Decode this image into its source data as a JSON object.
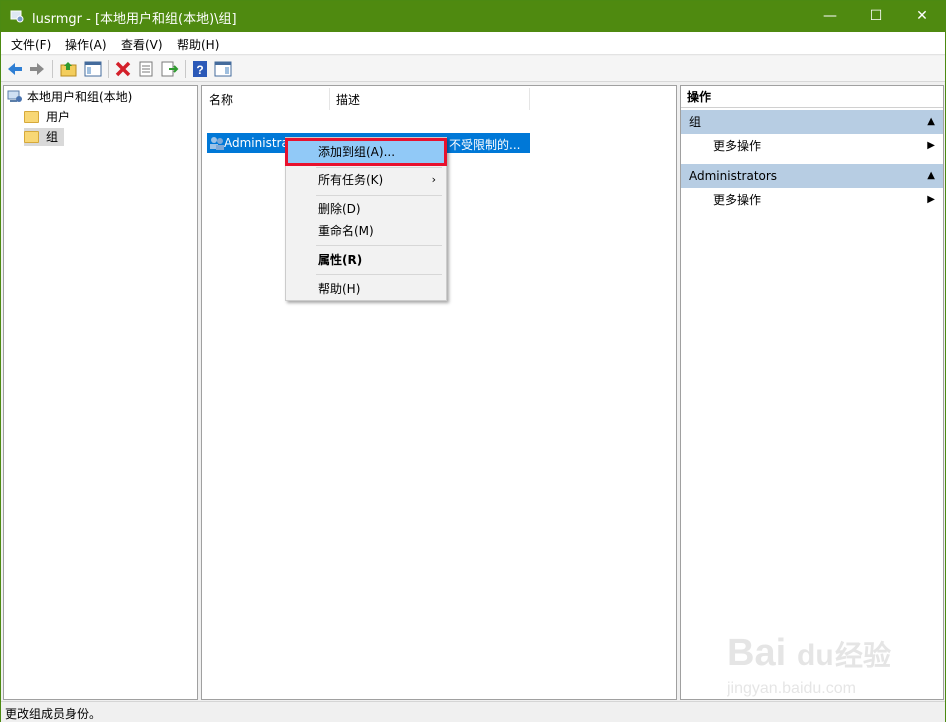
{
  "window": {
    "title": "lusrmgr - [本地用户和组(本地)\\组]",
    "accent": "#4f8a10",
    "min_glyph": "—",
    "max_glyph": "☐",
    "close_glyph": "✕"
  },
  "menubar": {
    "items": [
      {
        "label": "文件(F)"
      },
      {
        "label": "操作(A)"
      },
      {
        "label": "查看(V)"
      },
      {
        "label": "帮助(H)"
      }
    ]
  },
  "toolbar": {
    "icons": [
      "back-arrow-icon",
      "forward-arrow-icon",
      "up-folder-icon",
      "show-hide-tree-icon",
      "delete-icon",
      "properties-icon",
      "export-list-icon",
      "help-icon",
      "show-hide-action-pane-icon"
    ]
  },
  "tree": {
    "root": "本地用户和组(本地)",
    "items": [
      {
        "label": "用户"
      },
      {
        "label": "组"
      }
    ]
  },
  "list": {
    "columns": [
      "名称",
      "描述"
    ],
    "rows": [
      {
        "name": "Administra",
        "desc": "不受限制的..."
      }
    ]
  },
  "context_menu": {
    "items": [
      {
        "label": "添加到组(A)..."
      },
      {
        "label": "所有任务(K)"
      },
      {
        "label": "删除(D)"
      },
      {
        "label": "重命名(M)"
      },
      {
        "label": "属性(R)"
      },
      {
        "label": "帮助(H)"
      }
    ],
    "submenu_glyph": "›",
    "highlight_color": "#e8112d"
  },
  "actions": {
    "header": "操作",
    "groups": [
      {
        "title": "组",
        "item": "更多操作"
      },
      {
        "title": "Administrators",
        "item": "更多操作"
      }
    ],
    "collapse_glyph": "▲",
    "expand_glyph": "▶"
  },
  "status": {
    "text": "更改组成员身份。"
  },
  "watermark": {
    "brand": "Bai",
    "brand2": "du",
    "suffix": "经验",
    "url": "jingyan.baidu.com"
  }
}
